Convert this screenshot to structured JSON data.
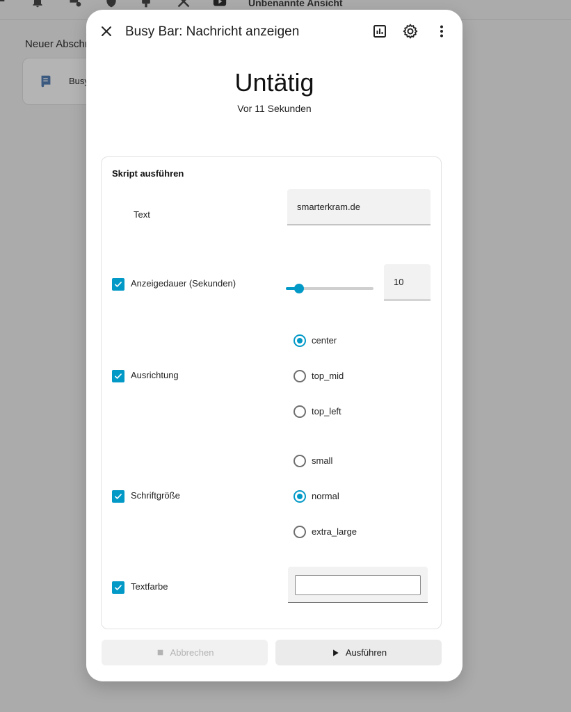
{
  "background": {
    "view_title": "Unbenannte Ansicht",
    "section_title": "Neuer Abschn",
    "card_label": "Busy",
    "toolbar_icons": [
      "network-icon",
      "bell-icon",
      "database-gear-icon",
      "shield-icon",
      "plug-icon",
      "tools-icon",
      "youtube-icon"
    ]
  },
  "dialog": {
    "title": "Busy Bar: Nachricht anzeigen",
    "state": "Untätig",
    "last_changed": "Vor 11 Sekunden"
  },
  "script": {
    "card_title": "Skript ausführen",
    "text_label": "Text",
    "text_value": "smarterkram.de",
    "duration_label": "Anzeigedauer (Sekunden)",
    "duration_value": "10",
    "duration_fraction": 0.15,
    "alignment_label": "Ausrichtung",
    "alignment_options": [
      "center",
      "top_mid",
      "top_left"
    ],
    "alignment_selected": "center",
    "font_size_label": "Schriftgröße",
    "font_size_options": [
      "small",
      "normal",
      "extra_large"
    ],
    "font_size_selected": "normal",
    "color_label": "Textfarbe",
    "color_value": "#ffffff"
  },
  "actions": {
    "cancel": "Abbrechen",
    "run": "Ausführen"
  },
  "colors": {
    "accent": "#0399c7"
  }
}
